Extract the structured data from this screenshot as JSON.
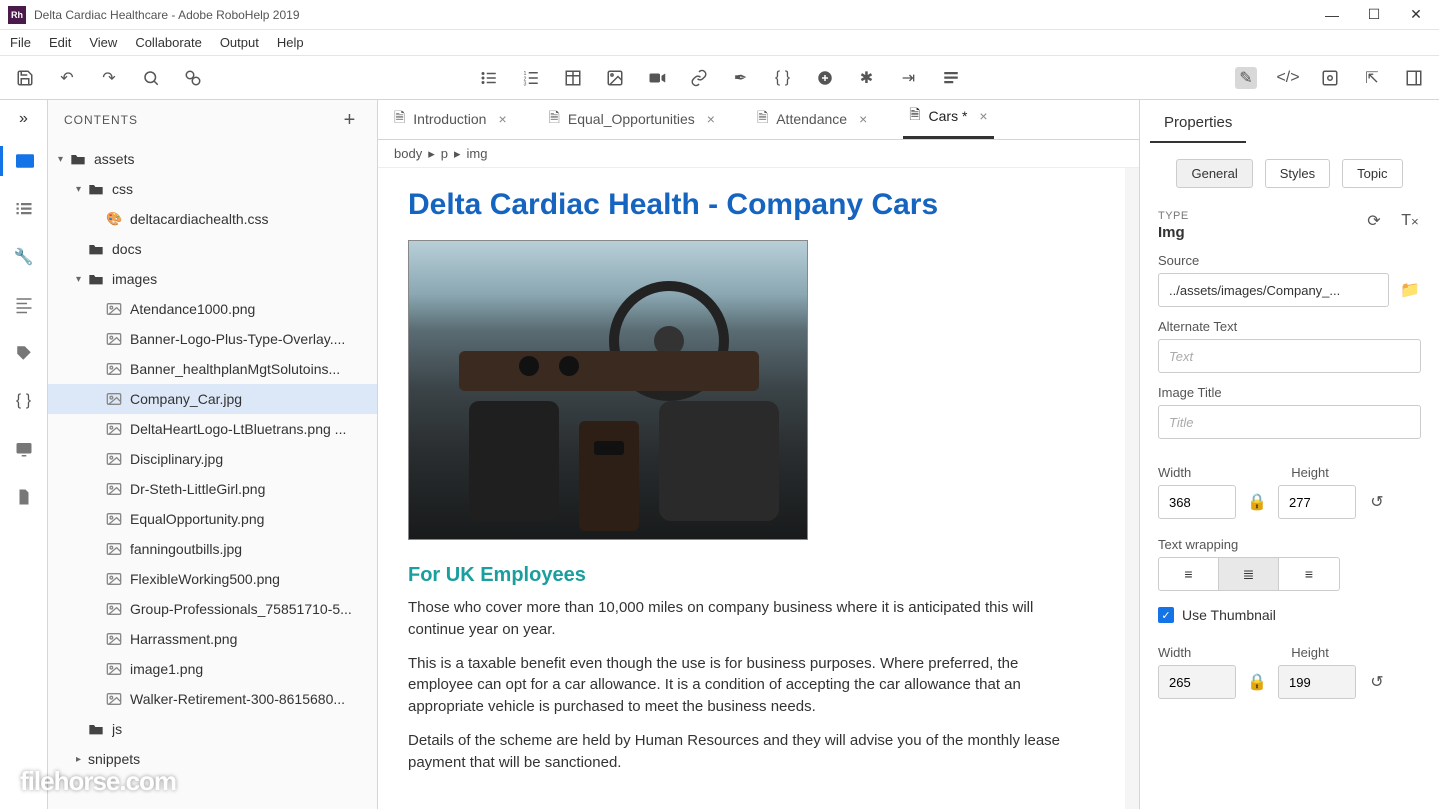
{
  "titlebar": {
    "app_icon_text": "Rh",
    "title": "Delta Cardiac Healthcare - Adobe RoboHelp 2019"
  },
  "menubar": [
    "File",
    "Edit",
    "View",
    "Collaborate",
    "Output",
    "Help"
  ],
  "contents": {
    "header": "CONTENTS",
    "tree": {
      "assets": "assets",
      "css": "css",
      "css_file": "deltacardiachealth.css",
      "docs": "docs",
      "images": "images",
      "image_files": [
        "Atendance1000.png",
        "Banner-Logo-Plus-Type-Overlay....",
        "Banner_healthplanMgtSolutoins...",
        "Company_Car.jpg",
        "DeltaHeartLogo-LtBluetrans.png ...",
        "Disciplinary.jpg",
        "Dr-Steth-LittleGirl.png",
        "EqualOpportunity.png",
        "fanningoutbills.jpg",
        "FlexibleWorking500.png",
        "Group-Professionals_75851710-5...",
        "Harrassment.png",
        "image1.png",
        "Walker-Retirement-300-8615680..."
      ],
      "js": "js",
      "snippets": "snippets"
    }
  },
  "tabs": [
    {
      "label": "Introduction",
      "active": false
    },
    {
      "label": "Equal_Opportunities",
      "active": false
    },
    {
      "label": "Attendance",
      "active": false
    },
    {
      "label": "Cars *",
      "active": true
    }
  ],
  "breadcrumb": [
    "body",
    "p",
    "img"
  ],
  "document": {
    "h1": "Delta Cardiac Health - Company Cars",
    "h2": "For UK Employees",
    "p1": "Those who cover more than 10,000 miles on company business where it is anticipated this will continue year on year.",
    "p2": "This is a taxable benefit even though the use is for business purposes. Where preferred, the employee can opt for a car allowance. It is a condition of accepting the car allowance that an appropriate vehicle is purchased to meet the business needs.",
    "p3": "Details of the scheme are held by Human Resources and they will advise you of the monthly lease payment that will be sanctioned."
  },
  "properties": {
    "title": "Properties",
    "tabs": [
      "General",
      "Styles",
      "Topic"
    ],
    "type_label": "TYPE",
    "type_value": "Img",
    "source_label": "Source",
    "source_value": "../assets/images/Company_...",
    "alt_label": "Alternate Text",
    "alt_placeholder": "Text",
    "imgtitle_label": "Image Title",
    "imgtitle_placeholder": "Title",
    "width_label": "Width",
    "width_value": "368",
    "height_label": "Height",
    "height_value": "277",
    "wrap_label": "Text wrapping",
    "thumb_label": "Use Thumbnail",
    "thumb_width_label": "Width",
    "thumb_width_value": "265",
    "thumb_height_label": "Height",
    "thumb_height_value": "199"
  },
  "watermark": "filehorse.com"
}
